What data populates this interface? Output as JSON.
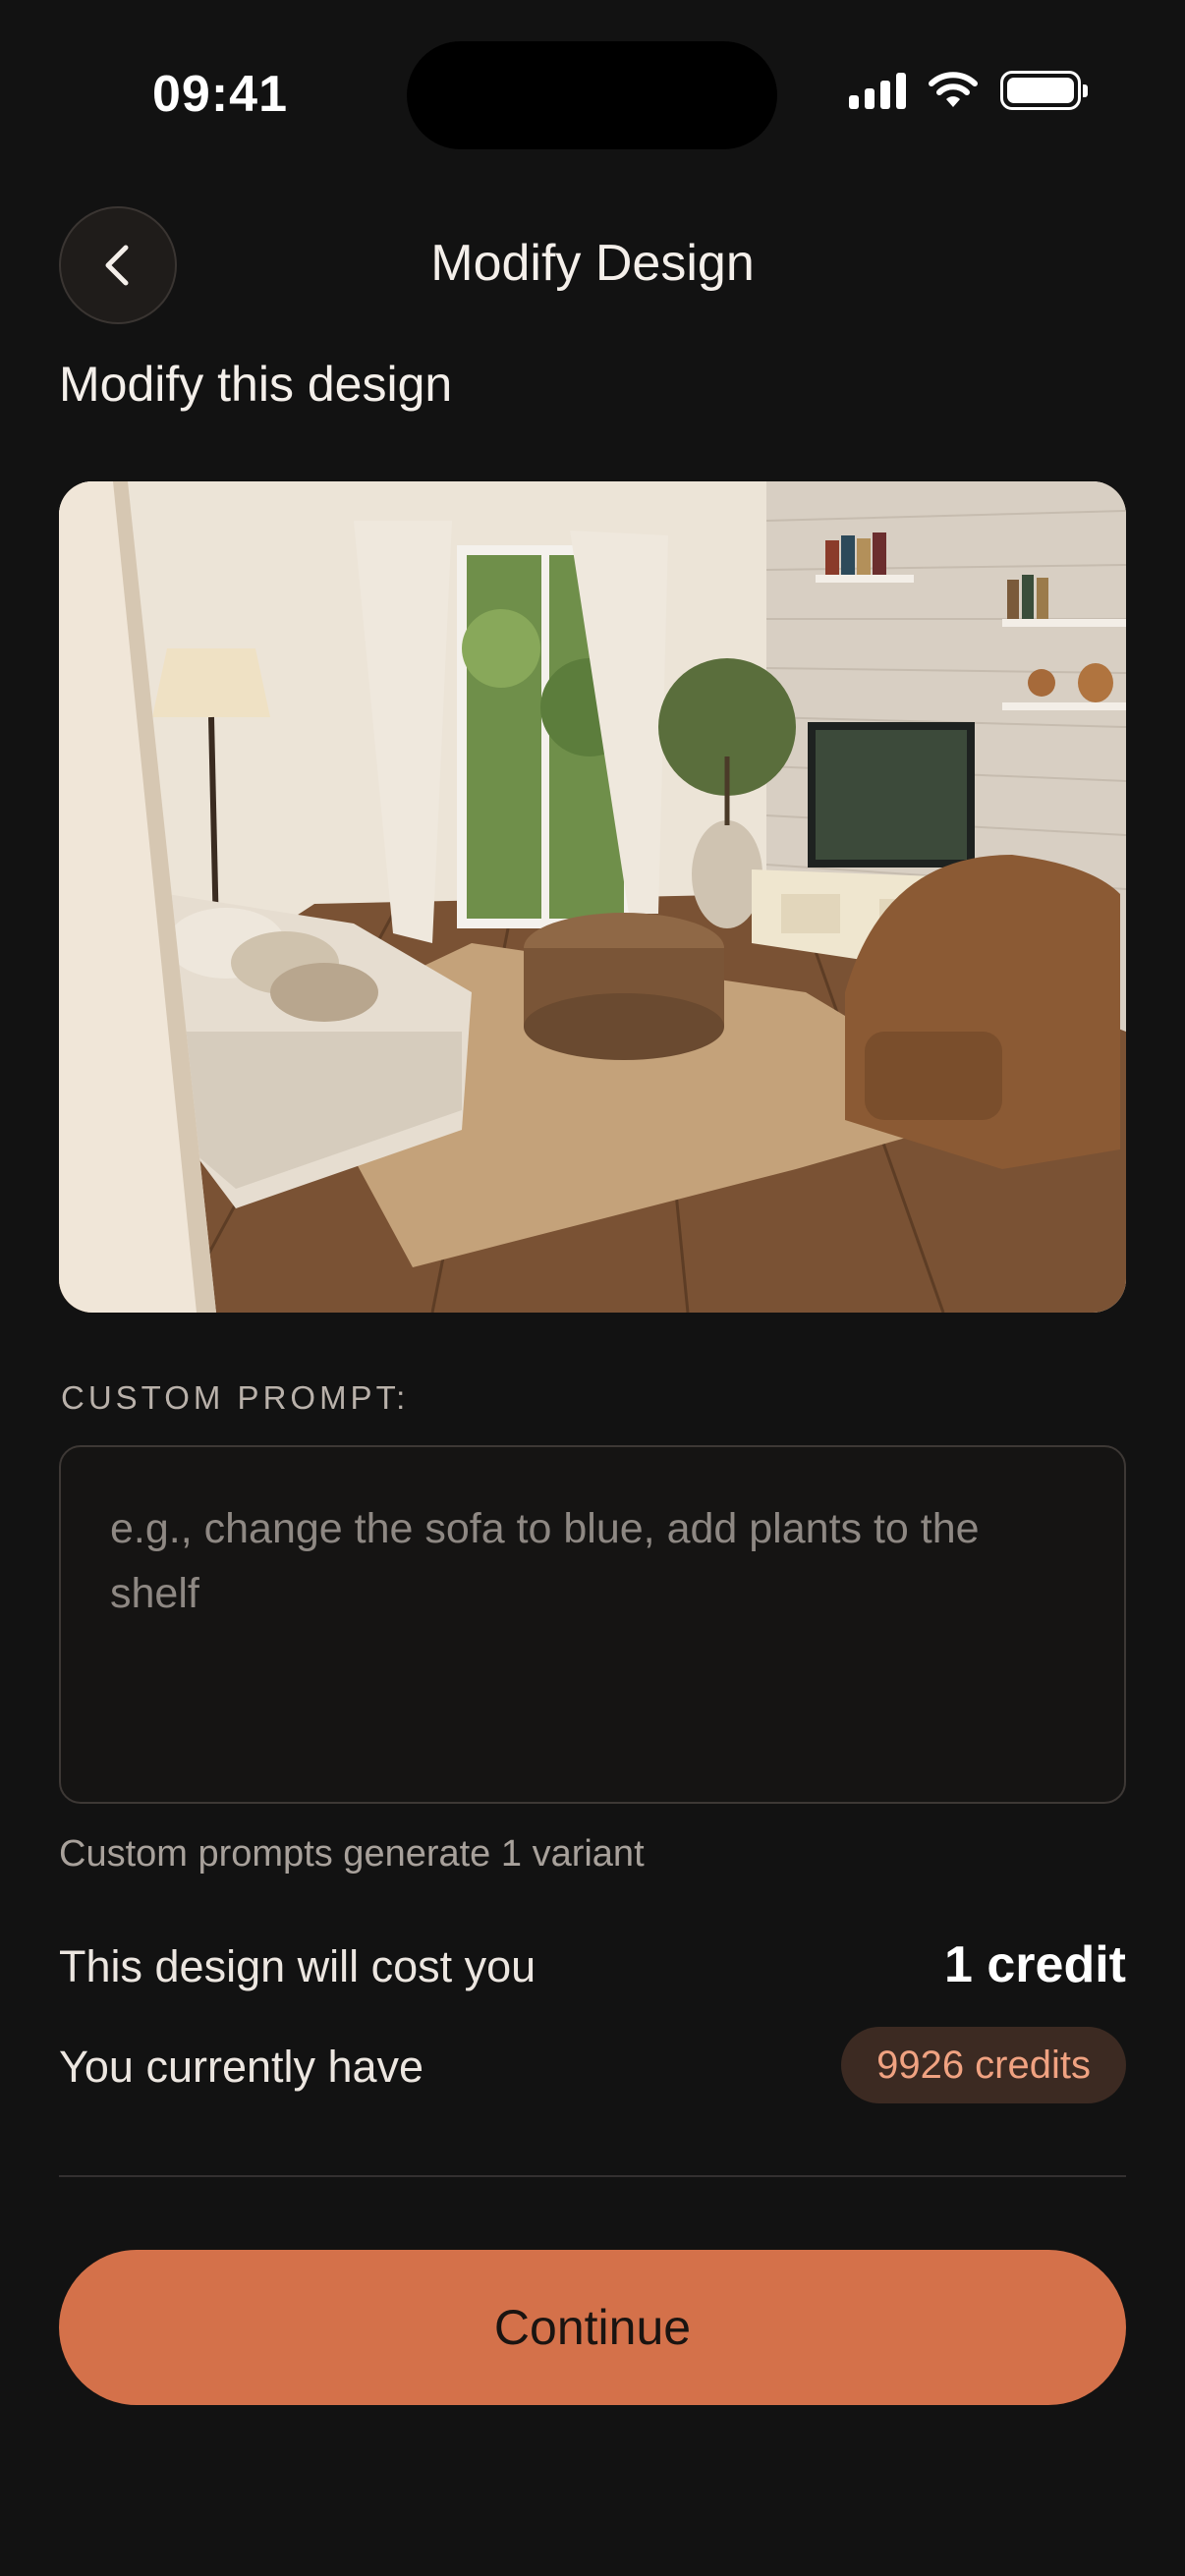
{
  "status_bar": {
    "time": "09:41",
    "icons": [
      "cellular-signal-icon",
      "wifi-icon",
      "battery-icon"
    ]
  },
  "header": {
    "title": "Modify Design",
    "back_icon": "chevron-left-icon"
  },
  "section_title": "Modify this design",
  "preview": {
    "subject": "living room photo"
  },
  "prompt": {
    "label": "CUSTOM PROMPT:",
    "value": "",
    "placeholder": "e.g., change the sofa to blue, add plants to the shelf",
    "hint": "Custom prompts generate 1 variant"
  },
  "cost": {
    "label": "This design will cost you",
    "value": "1 credit"
  },
  "balance": {
    "label": "You currently have",
    "value": "9926 credits"
  },
  "actions": {
    "continue_label": "Continue"
  },
  "colors": {
    "background": "#121212",
    "accent": "#d4714a",
    "badge_bg": "#3c2a22",
    "badge_text": "#f0a281"
  }
}
